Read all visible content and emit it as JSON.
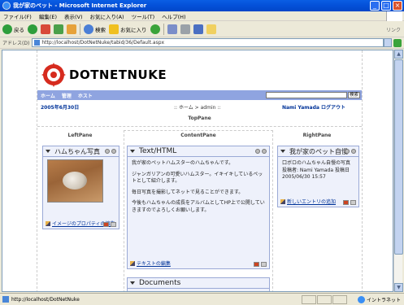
{
  "window": {
    "title": "我が家のペット - Microsoft Internet Explorer",
    "minimize": "_",
    "maximize": "□",
    "close": "×"
  },
  "menu": [
    "ファイル(F)",
    "編集(E)",
    "表示(V)",
    "お気に入り(A)",
    "ツール(T)",
    "ヘルプ(H)"
  ],
  "toolbar": {
    "back_label": "戻る",
    "search_label": "検索",
    "favorites_label": "お気に入り",
    "links_label": "リンク"
  },
  "address": {
    "label": "アドレス(D)",
    "url": "http://localhost/DotNetNuke/tabid/36/Default.aspx",
    "go_label": "移動"
  },
  "page": {
    "logo_text": "DOTNETNUKE",
    "nav": [
      "ホーム",
      "管理",
      "ホスト"
    ],
    "search_button": "検索",
    "date": "2005年6月30日",
    "breadcrumb": ":: ホーム > admin ::",
    "user": "Nami Yamada  ログアウト",
    "top_pane": "TopPane",
    "left_pane": "LeftPane",
    "content_pane": "ContentPane",
    "right_pane": "RightPane"
  },
  "modules": {
    "left": {
      "title": "ハムちゃん写真",
      "footer": "イメージのプロパティの編集"
    },
    "text": {
      "title": "Text/HTML",
      "body": [
        "我が家のペットハムスターのハムちゃんです。",
        "ジャンガリアンの可愛いハムスター。イキイキしているペットとして紹介します。",
        "毎日写真を撮影してネットで見ることができます。",
        "今後もハムちゃんの成長をアルバムとしてHP上で公開していきますのでよろしくお願いします。"
      ],
      "footer": "テキストの編集"
    },
    "documents": {
      "title": "Documents"
    },
    "right": {
      "title": "我が家のペット自慢",
      "body": [
        "口ボロのハムちゃん自慢の写真",
        "投稿者: Nami Yamada  投稿日",
        "2005/06/30  15:57"
      ],
      "footer": "新しいエントリの追加"
    }
  },
  "status": {
    "url": "http://localhost/DotNetNuke",
    "zone": "イントラネット"
  }
}
